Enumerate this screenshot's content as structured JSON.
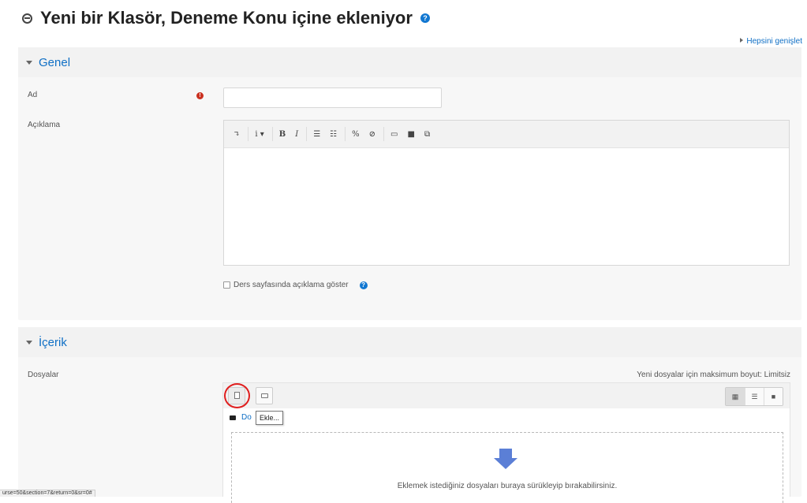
{
  "page": {
    "title": "Yeni bir Klasör, Deneme Konu içine ekleniyor",
    "help_icon": "question-circle-icon",
    "expand_all": "Hepsini genişlet"
  },
  "sections": {
    "genel": {
      "legend": "Genel",
      "ad_label": "Ad",
      "ad_value": "",
      "aciklama_label": "Açıklama",
      "editor_toolbar": [
        "↴",
        "i ▾",
        "B",
        "I",
        "☰",
        "☷",
        "%",
        "⊘",
        "▭",
        "■",
        "⧉"
      ],
      "show_description": "Ders sayfasında açıklama göster"
    },
    "icerik": {
      "legend": "İçerik",
      "dosyalar_label": "Dosyalar",
      "max_size": "Yeni dosyalar için maksimum boyut: Limitsiz",
      "path_text": "Do",
      "tooltip": "Ekle...",
      "view_buttons": [
        "▦",
        "☰",
        "■"
      ],
      "drop_text": "Eklemek istediğiniz dosyaları buraya sürükleyip bırakabilirsiniz."
    }
  },
  "status_bar": {
    "url": "urse=50&section=7&return=0&sr=0#"
  }
}
